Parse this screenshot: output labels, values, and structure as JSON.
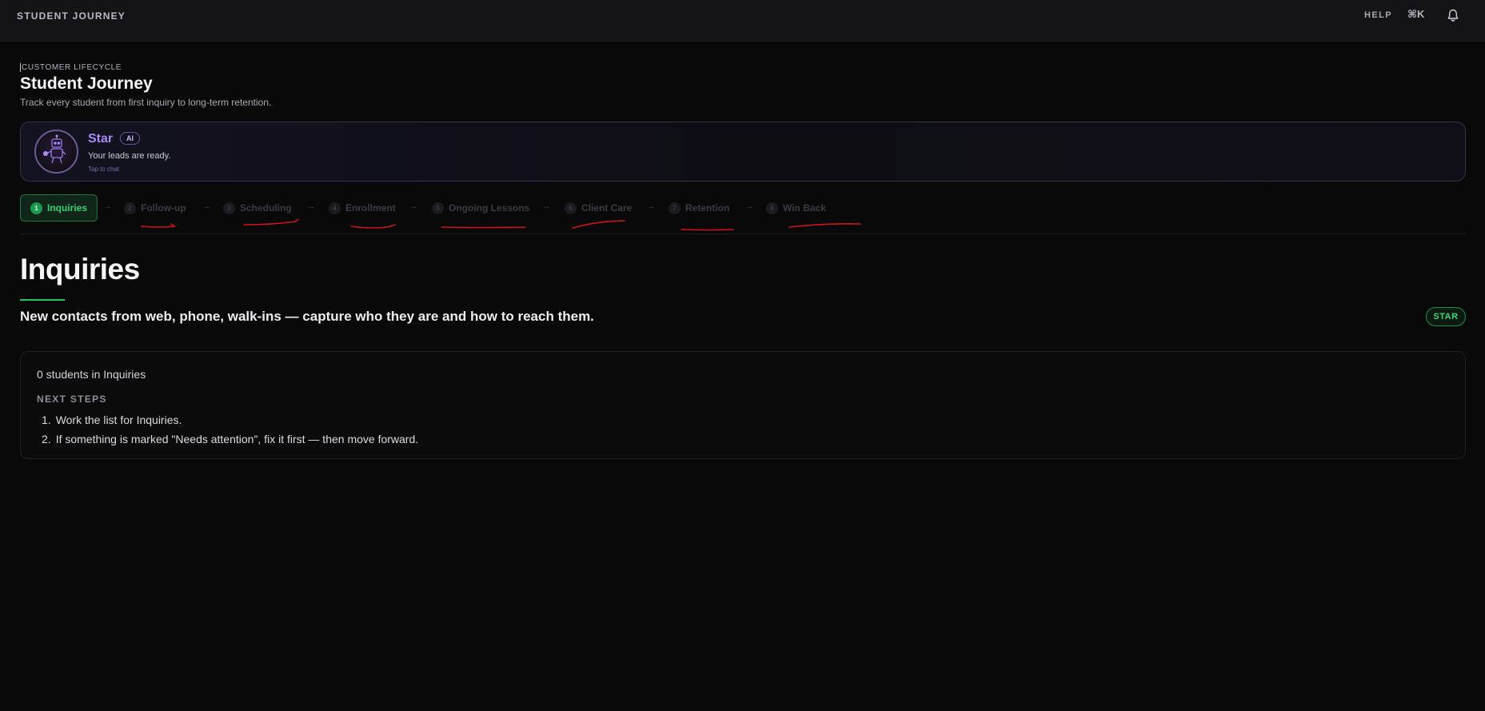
{
  "topbar": {
    "brand": "STUDENT JOURNEY",
    "help": "HELP",
    "shortcut": "⌘K",
    "bell_icon": "bell-icon"
  },
  "header": {
    "eyebrow": "CUSTOMER LIFECYCLE",
    "title": "Student Journey",
    "subtitle": "Track every student from first inquiry to long-term retention."
  },
  "assistant": {
    "name": "Star",
    "badge": "AI",
    "message": "Your leads are ready.",
    "hint": "Tap to chat",
    "avatar_icon": "robot-avatar-icon"
  },
  "stepper": {
    "steps": [
      {
        "num": "1",
        "label": "Inquiries",
        "active": true
      },
      {
        "num": "2",
        "label": "Follow-up"
      },
      {
        "num": "3",
        "label": "Scheduling"
      },
      {
        "num": "4",
        "label": "Enrollment"
      },
      {
        "num": "5",
        "label": "Ongoing Lessons"
      },
      {
        "num": "6",
        "label": "Client Care"
      },
      {
        "num": "7",
        "label": "Retention"
      },
      {
        "num": "8",
        "label": "Win Back"
      }
    ],
    "arrow": "→"
  },
  "section": {
    "title": "Inquiries",
    "description": "New contacts from web, phone, walk-ins — capture who they are and how to reach them.",
    "star_button": "STAR"
  },
  "panel": {
    "count": "0 students in Inquiries",
    "next_label": "NEXT STEPS",
    "next_steps": [
      {
        "num": "1.",
        "text": "Work the list for Inquiries."
      },
      {
        "num": "2.",
        "text": "If something is marked \"Needs attention\", fix it first — then move forward."
      }
    ]
  },
  "colors": {
    "accent_green": "#22c55e",
    "accent_purple": "#a98cf5",
    "annotation_red": "#d0121b"
  }
}
